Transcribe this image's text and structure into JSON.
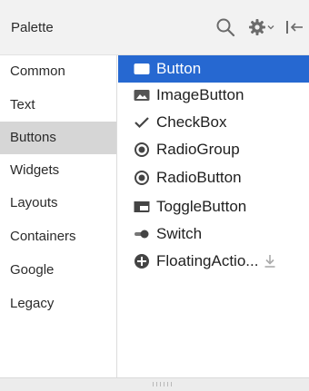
{
  "palette": {
    "title": "Palette",
    "toolbar_icons": [
      "search-icon",
      "gear-icon",
      "chevron-down-icon",
      "collapse-icon"
    ]
  },
  "categories": [
    {
      "label": "Common",
      "selected": false
    },
    {
      "label": "Text",
      "selected": false
    },
    {
      "label": "Buttons",
      "selected": true
    },
    {
      "label": "Widgets",
      "selected": false
    },
    {
      "label": "Layouts",
      "selected": false
    },
    {
      "label": "Containers",
      "selected": false
    },
    {
      "label": "Google",
      "selected": false
    },
    {
      "label": "Legacy",
      "selected": false
    }
  ],
  "items": [
    {
      "label": "Button",
      "icon": "button-icon",
      "selected": true
    },
    {
      "label": "ImageButton",
      "icon": "image-button-icon",
      "selected": false
    },
    {
      "label": "CheckBox",
      "icon": "checkmark-icon",
      "selected": false
    },
    {
      "label": "RadioGroup",
      "icon": "radio-group-icon",
      "selected": false
    },
    {
      "label": "RadioButton",
      "icon": "radio-button-icon",
      "selected": false
    },
    {
      "label": "ToggleButton",
      "icon": "toggle-button-icon",
      "selected": false
    },
    {
      "label": "Switch",
      "icon": "switch-icon",
      "selected": false
    },
    {
      "label": "FloatingActio...",
      "icon": "plus-circle-icon",
      "selected": false,
      "download_icon": "download-icon"
    }
  ],
  "colors": {
    "selection_accent": "#2668d1",
    "category_selected_bg": "#d6d6d6",
    "header_bg": "#f2f2f2"
  }
}
